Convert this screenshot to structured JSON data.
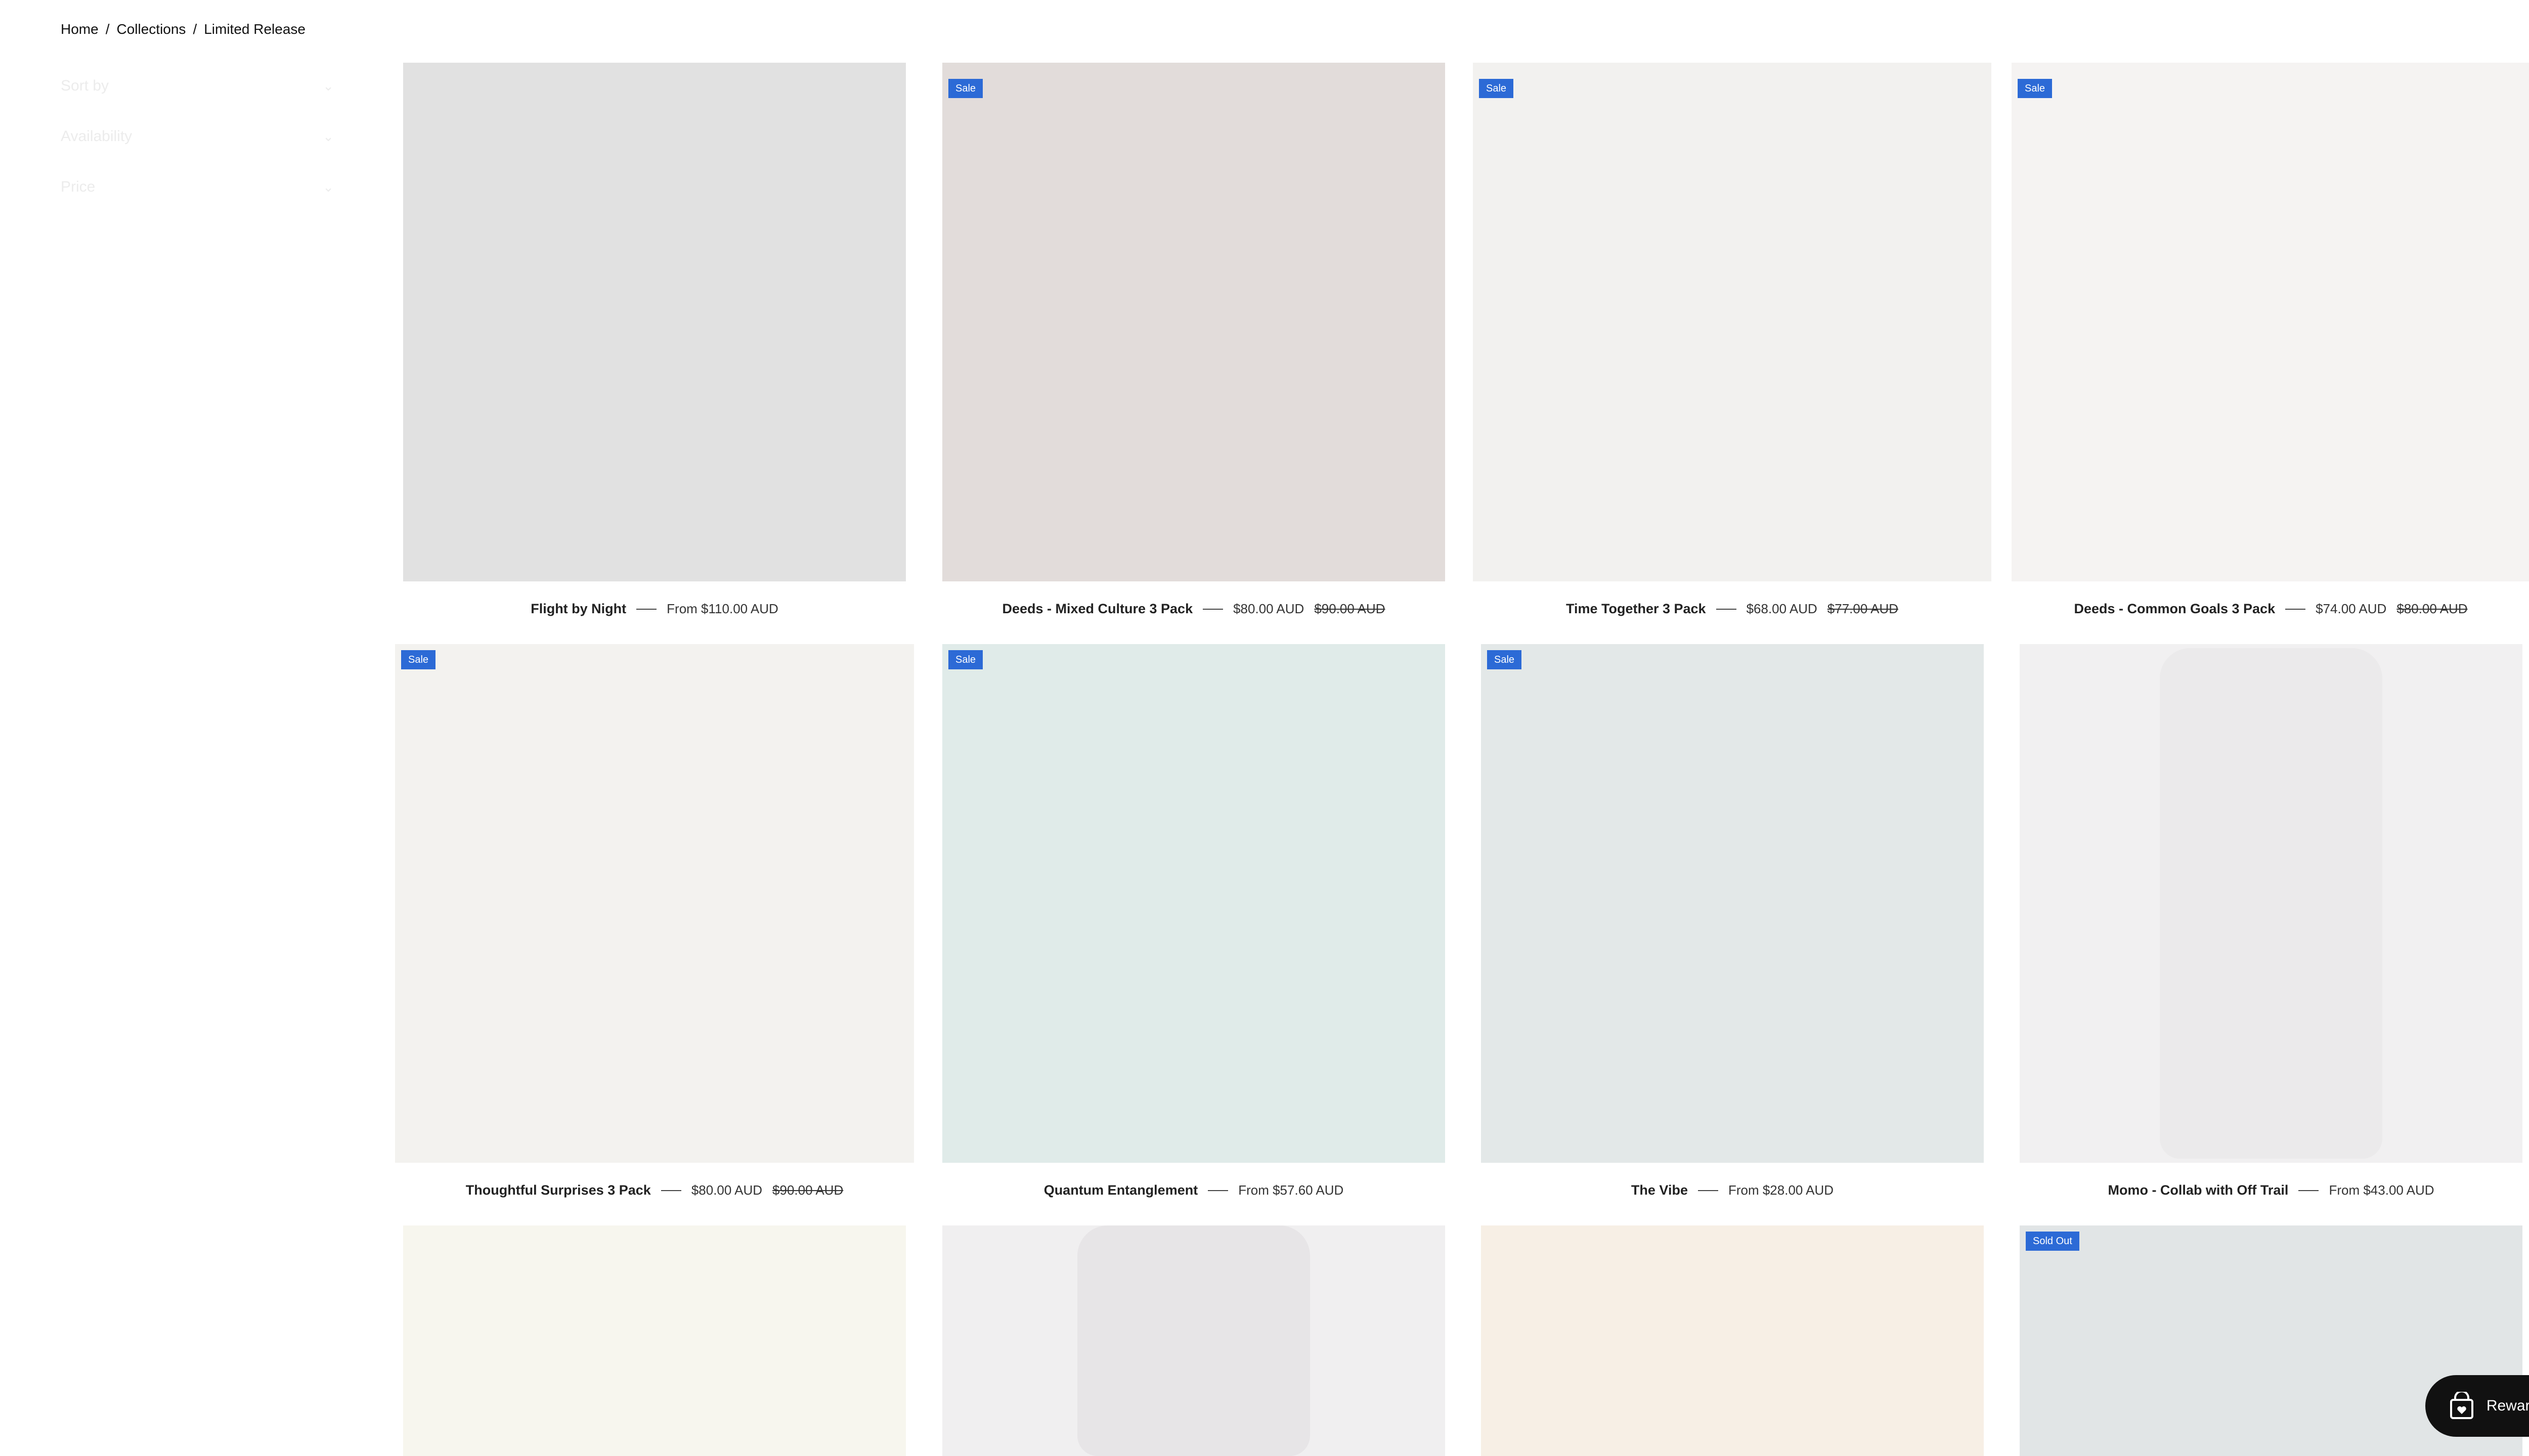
{
  "breadcrumb": {
    "home": "Home",
    "collections": "Collections",
    "current": "Limited Release",
    "sep": "/"
  },
  "filters": [
    {
      "label": "Sort by"
    },
    {
      "label": "Availability"
    },
    {
      "label": "Price"
    }
  ],
  "products": [
    {
      "title": "Flight by Night",
      "price": "From $110.00 AUD",
      "compare": "",
      "badge": ""
    },
    {
      "title": "Deeds - Mixed Culture 3 Pack",
      "price": "$80.00 AUD",
      "compare": "$90.00 AUD",
      "badge": "Sale"
    },
    {
      "title": "Time Together 3 Pack",
      "price": "$68.00 AUD",
      "compare": "$77.00 AUD",
      "badge": "Sale"
    },
    {
      "title": "Deeds - Common Goals 3 Pack",
      "price": "$74.00 AUD",
      "compare": "$80.00 AUD",
      "badge": "Sale"
    },
    {
      "title": "Thoughtful Surprises 3 Pack",
      "price": "$80.00 AUD",
      "compare": "$90.00 AUD",
      "badge": "Sale"
    },
    {
      "title": "Quantum Entanglement",
      "price": "From $57.60 AUD",
      "compare": "",
      "badge": "Sale"
    },
    {
      "title": "The Vibe",
      "price": "From $28.00 AUD",
      "compare": "",
      "badge": "Sale"
    },
    {
      "title": "Momo - Collab with Off Trail",
      "price": "From $43.00 AUD",
      "compare": "",
      "badge": ""
    },
    {
      "title": "",
      "price": "",
      "compare": "",
      "badge": ""
    },
    {
      "title": "",
      "price": "",
      "compare": "",
      "badge": ""
    },
    {
      "title": "",
      "price": "",
      "compare": "",
      "badge": ""
    },
    {
      "title": "",
      "price": "",
      "compare": "",
      "badge": "Sold Out"
    }
  ],
  "rewards": {
    "label": "Rewards"
  },
  "colors": {
    "badge": "#2c6ad6",
    "rewards_bg": "#111111",
    "tiles": [
      "#e1e1e1",
      "#e2dcda",
      "#f2f1ef",
      "#f5f3f2",
      "#f3f2ef",
      "#e0ebe9",
      "#e3e8e8",
      "#f1f0f1",
      "#f7f6ee",
      "#f0eff0",
      "#f7efe5",
      "#e1e5e6"
    ]
  }
}
